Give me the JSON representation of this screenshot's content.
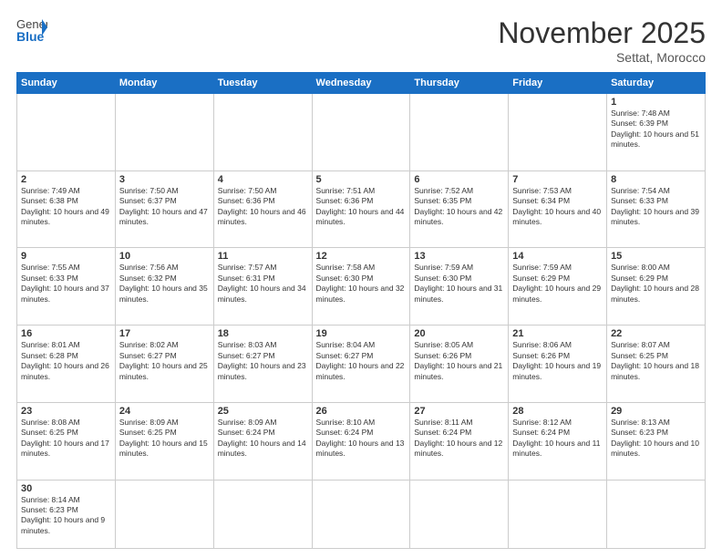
{
  "header": {
    "logo_general": "General",
    "logo_blue": "Blue",
    "month_title": "November 2025",
    "location": "Settat, Morocco"
  },
  "weekdays": [
    "Sunday",
    "Monday",
    "Tuesday",
    "Wednesday",
    "Thursday",
    "Friday",
    "Saturday"
  ],
  "days": {
    "1": {
      "sunrise": "7:48 AM",
      "sunset": "6:39 PM",
      "daylight": "10 hours and 51 minutes."
    },
    "2": {
      "sunrise": "7:49 AM",
      "sunset": "6:38 PM",
      "daylight": "10 hours and 49 minutes."
    },
    "3": {
      "sunrise": "7:50 AM",
      "sunset": "6:37 PM",
      "daylight": "10 hours and 47 minutes."
    },
    "4": {
      "sunrise": "7:50 AM",
      "sunset": "6:36 PM",
      "daylight": "10 hours and 46 minutes."
    },
    "5": {
      "sunrise": "7:51 AM",
      "sunset": "6:36 PM",
      "daylight": "10 hours and 44 minutes."
    },
    "6": {
      "sunrise": "7:52 AM",
      "sunset": "6:35 PM",
      "daylight": "10 hours and 42 minutes."
    },
    "7": {
      "sunrise": "7:53 AM",
      "sunset": "6:34 PM",
      "daylight": "10 hours and 40 minutes."
    },
    "8": {
      "sunrise": "7:54 AM",
      "sunset": "6:33 PM",
      "daylight": "10 hours and 39 minutes."
    },
    "9": {
      "sunrise": "7:55 AM",
      "sunset": "6:33 PM",
      "daylight": "10 hours and 37 minutes."
    },
    "10": {
      "sunrise": "7:56 AM",
      "sunset": "6:32 PM",
      "daylight": "10 hours and 35 minutes."
    },
    "11": {
      "sunrise": "7:57 AM",
      "sunset": "6:31 PM",
      "daylight": "10 hours and 34 minutes."
    },
    "12": {
      "sunrise": "7:58 AM",
      "sunset": "6:30 PM",
      "daylight": "10 hours and 32 minutes."
    },
    "13": {
      "sunrise": "7:59 AM",
      "sunset": "6:30 PM",
      "daylight": "10 hours and 31 minutes."
    },
    "14": {
      "sunrise": "7:59 AM",
      "sunset": "6:29 PM",
      "daylight": "10 hours and 29 minutes."
    },
    "15": {
      "sunrise": "8:00 AM",
      "sunset": "6:29 PM",
      "daylight": "10 hours and 28 minutes."
    },
    "16": {
      "sunrise": "8:01 AM",
      "sunset": "6:28 PM",
      "daylight": "10 hours and 26 minutes."
    },
    "17": {
      "sunrise": "8:02 AM",
      "sunset": "6:27 PM",
      "daylight": "10 hours and 25 minutes."
    },
    "18": {
      "sunrise": "8:03 AM",
      "sunset": "6:27 PM",
      "daylight": "10 hours and 23 minutes."
    },
    "19": {
      "sunrise": "8:04 AM",
      "sunset": "6:27 PM",
      "daylight": "10 hours and 22 minutes."
    },
    "20": {
      "sunrise": "8:05 AM",
      "sunset": "6:26 PM",
      "daylight": "10 hours and 21 minutes."
    },
    "21": {
      "sunrise": "8:06 AM",
      "sunset": "6:26 PM",
      "daylight": "10 hours and 19 minutes."
    },
    "22": {
      "sunrise": "8:07 AM",
      "sunset": "6:25 PM",
      "daylight": "10 hours and 18 minutes."
    },
    "23": {
      "sunrise": "8:08 AM",
      "sunset": "6:25 PM",
      "daylight": "10 hours and 17 minutes."
    },
    "24": {
      "sunrise": "8:09 AM",
      "sunset": "6:25 PM",
      "daylight": "10 hours and 15 minutes."
    },
    "25": {
      "sunrise": "8:09 AM",
      "sunset": "6:24 PM",
      "daylight": "10 hours and 14 minutes."
    },
    "26": {
      "sunrise": "8:10 AM",
      "sunset": "6:24 PM",
      "daylight": "10 hours and 13 minutes."
    },
    "27": {
      "sunrise": "8:11 AM",
      "sunset": "6:24 PM",
      "daylight": "10 hours and 12 minutes."
    },
    "28": {
      "sunrise": "8:12 AM",
      "sunset": "6:24 PM",
      "daylight": "10 hours and 11 minutes."
    },
    "29": {
      "sunrise": "8:13 AM",
      "sunset": "6:23 PM",
      "daylight": "10 hours and 10 minutes."
    },
    "30": {
      "sunrise": "8:14 AM",
      "sunset": "6:23 PM",
      "daylight": "10 hours and 9 minutes."
    }
  },
  "labels": {
    "sunrise": "Sunrise:",
    "sunset": "Sunset:",
    "daylight": "Daylight:"
  }
}
